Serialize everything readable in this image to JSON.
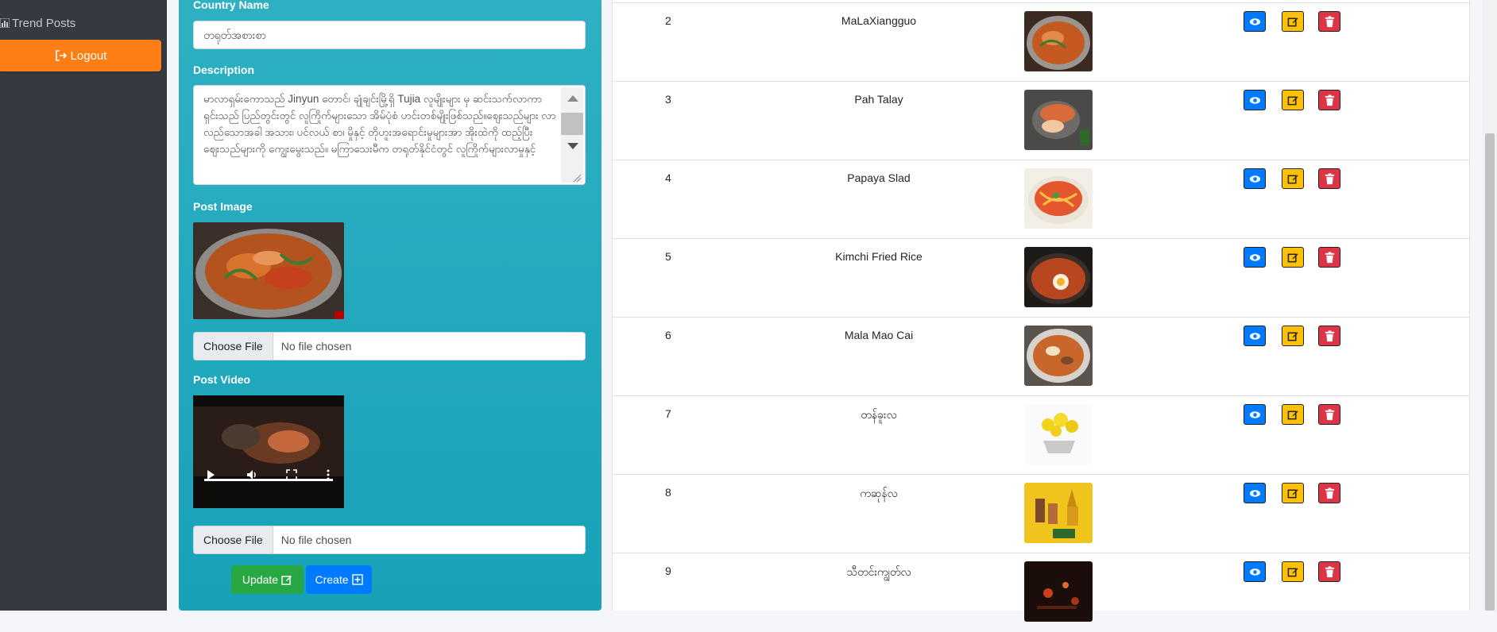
{
  "sidebar": {
    "trend_posts_label": "Trend Posts",
    "logout_label": "Logout"
  },
  "form": {
    "country_label": "Country Name",
    "country_value": "တရုတ်အစားစာ",
    "description_label": "Description",
    "description_value": "မာလာရှမ်းကောသည် Jinyun တောင်၊ ချုံချင်းမြို့ရှိ Tujia လူမျိုးများ မှ ဆင်းသက်လာကာ ရှင်းသည် ပြည်တွင်းတွင် လူကြိုက်များသော အိမ်ပုံစံ ဟင်းတစ်မျိုးဖြစ်သည်။ဈေးသည်များ လာလည်သောအခါ အသား၊ ပင်လယ် စာ၊ မှိုနှင့် တိုဟူးအရောင်းမှုများအာ အိုးထဲကို ထည့်ပြီး ဈေးသည်များကို ကျွေးမွေးသည်။ မကြာသေးမီက တရုတ်နိုင်ငံတွင် လူကြိုက်များလာမှုနှင့်",
    "post_image_label": "Post Image",
    "choose_file_label": "Choose File",
    "no_file_label": "No file chosen",
    "post_video_label": "Post Video",
    "choose_file_label_2": "Choose File",
    "no_file_label_2": "No file chosen",
    "update_label": "Update",
    "create_label": "Create"
  },
  "rows": [
    {
      "num": "2",
      "name": "MaLaXiangguo",
      "img": "dish-shrimp"
    },
    {
      "num": "3",
      "name": "Pah Talay",
      "img": "dish-seafood"
    },
    {
      "num": "4",
      "name": "Papaya Slad",
      "img": "dish-papaya"
    },
    {
      "num": "5",
      "name": "Kimchi Fried Rice",
      "img": "dish-rice"
    },
    {
      "num": "6",
      "name": "Mala Mao Cai",
      "img": "dish-soup"
    },
    {
      "num": "7",
      "name": "တန်ခူးလ",
      "img": "flower-bowl"
    },
    {
      "num": "8",
      "name": "ကဆုန်လ",
      "img": "pagoda-poster"
    },
    {
      "num": "9",
      "name": "သီတင်းကျွတ်လ",
      "img": "night-lights"
    }
  ],
  "colors": {
    "sidebar": "#343a40",
    "form_bg": "#17a2b8",
    "logout": "#fd7e14",
    "view": "#007bff",
    "edit": "#ffc107",
    "delete": "#dc3545",
    "update": "#28a745",
    "create": "#007bff"
  }
}
